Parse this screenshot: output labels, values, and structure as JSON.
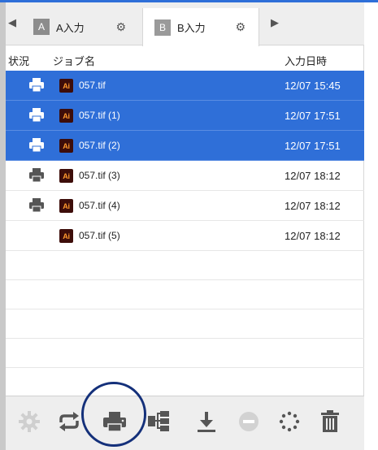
{
  "tabs": [
    {
      "letter": "A",
      "label": "A入力"
    },
    {
      "letter": "B",
      "label": "B入力"
    }
  ],
  "columns": {
    "status": "状況",
    "job": "ジョブ名",
    "date": "入力日時"
  },
  "file_icon_label": "Ai",
  "jobs": [
    {
      "name": "057.tif",
      "date": "12/07 15:45",
      "selected": true,
      "status_icon": "printer-icon"
    },
    {
      "name": "057.tif (1)",
      "date": "12/07 17:51",
      "selected": true,
      "status_icon": "printer-icon"
    },
    {
      "name": "057.tif (2)",
      "date": "12/07 17:51",
      "selected": true,
      "status_icon": "printer-icon"
    },
    {
      "name": "057.tif (3)",
      "date": "12/07 18:12",
      "selected": false,
      "status_icon": "printer-icon"
    },
    {
      "name": "057.tif (4)",
      "date": "12/07 18:12",
      "selected": false,
      "status_icon": "printer-icon"
    },
    {
      "name": "057.tif (5)",
      "date": "12/07 18:12",
      "selected": false,
      "status_icon": ""
    }
  ],
  "toolbar_icons": [
    "gear-icon",
    "refresh-icon",
    "print-icon",
    "tree-icon",
    "download-icon",
    "stop-icon",
    "spinner-icon",
    "trash-icon"
  ],
  "colors": {
    "accent": "#2f6fd8",
    "circle": "#14307a",
    "ai_bg": "#3d0d0a",
    "ai_fg": "#ff9a2e"
  }
}
